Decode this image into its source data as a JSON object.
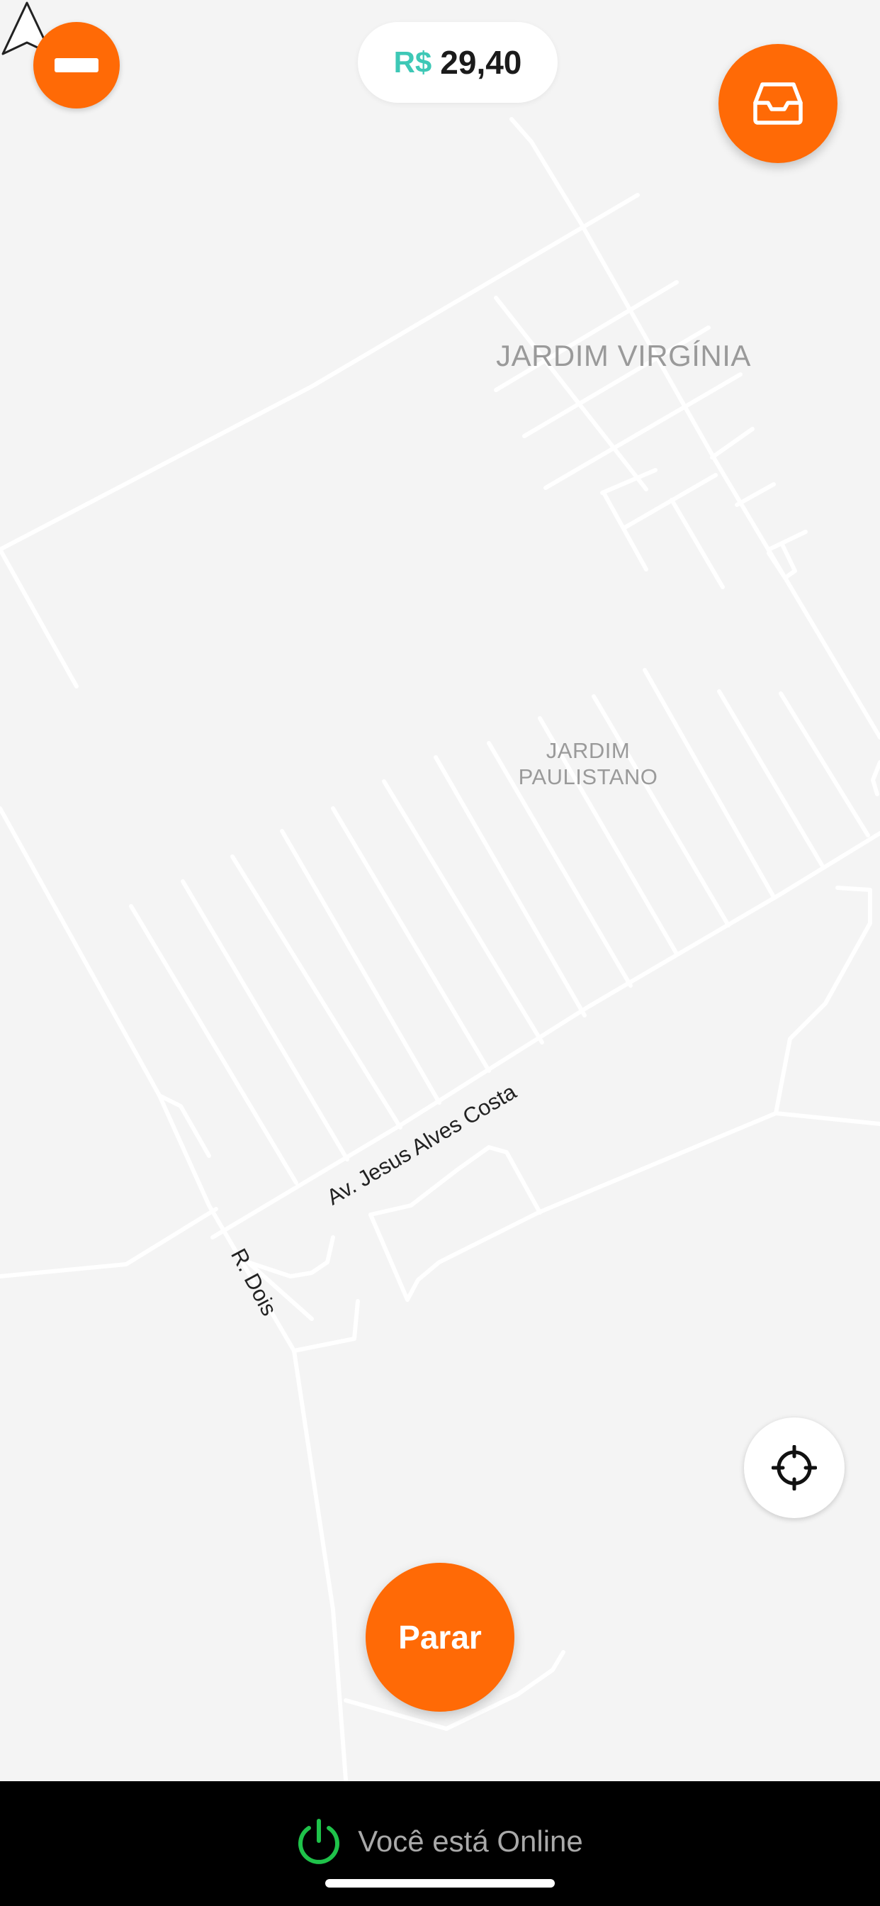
{
  "map": {
    "neighborhood_1": "JARDIM VIRGÍNIA",
    "neighborhood_2_line1": "JARDIM",
    "neighborhood_2_line2": "PAULISTANO",
    "street_1": "Av. Jesus Alves Costa",
    "street_2": "R. Dois"
  },
  "header": {
    "minus_icon": "minus-icon",
    "balance_currency": "R$",
    "balance_amount": "29,40",
    "inbox_icon": "inbox-icon"
  },
  "controls": {
    "locate_icon": "crosshair-icon",
    "stop_label": "Parar"
  },
  "status": {
    "power_icon": "power-icon",
    "text": "Você está Online"
  },
  "colors": {
    "accent": "#ff6a06",
    "currency": "#3ec8b6",
    "online": "#1fc24a",
    "map_background": "#f4f4f4",
    "road": "#ffffff"
  }
}
